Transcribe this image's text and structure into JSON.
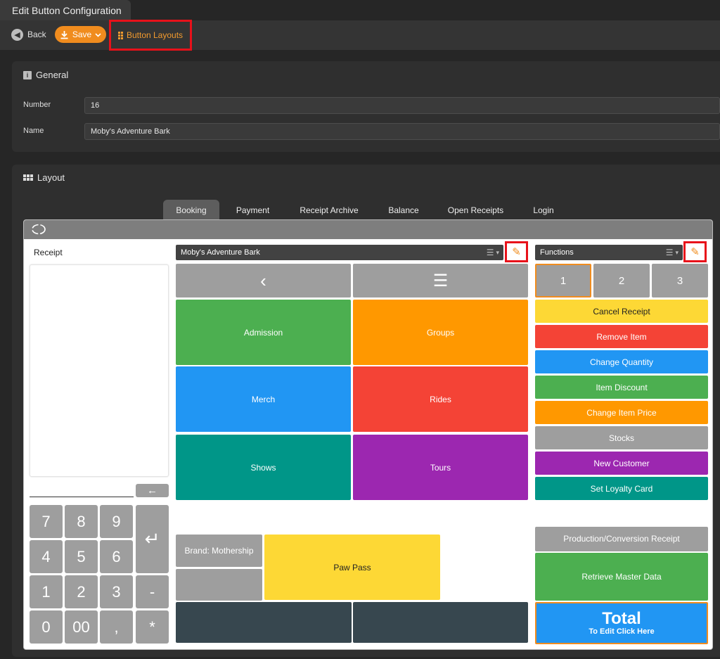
{
  "window": {
    "title": "Edit Button Configuration"
  },
  "toolbar": {
    "back_label": "Back",
    "save_label": "Save",
    "layouts_label": "Button Layouts"
  },
  "general": {
    "title": "General",
    "number_label": "Number",
    "number_value": "16",
    "name_label": "Name",
    "name_value": "Moby's Adventure Bark"
  },
  "layout": {
    "title": "Layout",
    "tabs": [
      {
        "label": "Booking",
        "active": true
      },
      {
        "label": "Payment"
      },
      {
        "label": "Receipt Archive"
      },
      {
        "label": "Balance"
      },
      {
        "label": "Open Receipts"
      },
      {
        "label": "Login"
      }
    ]
  },
  "pos": {
    "receipt_label": "Receipt",
    "main_dropdown": "Moby's Adventure Bark",
    "functions_dropdown": "Functions",
    "nav": {
      "back_glyph": "‹",
      "menu_glyph": "☰"
    },
    "category_tiles": [
      {
        "label": "Admission",
        "color": "#4caf50"
      },
      {
        "label": "Groups",
        "color": "#ff9800"
      },
      {
        "label": "Merch",
        "color": "#2196f3"
      },
      {
        "label": "Rides",
        "color": "#f44336"
      },
      {
        "label": "Shows",
        "color": "#009688"
      },
      {
        "label": "Tours",
        "color": "#9c27b0"
      }
    ],
    "brand_label": "Brand: Mothership",
    "paw_pass_label": "Paw Pass",
    "page_tabs": [
      "1",
      "2",
      "3"
    ],
    "functions": [
      {
        "label": "Cancel Receipt",
        "color": "#fdd835"
      },
      {
        "label": "Remove Item",
        "color": "#f44336"
      },
      {
        "label": "Change Quantity",
        "color": "#2196f3"
      },
      {
        "label": "Item Discount",
        "color": "#4caf50"
      },
      {
        "label": "Change Item Price",
        "color": "#ff9800"
      },
      {
        "label": "Stocks",
        "color": "#9e9e9e"
      },
      {
        "label": "New Customer",
        "color": "#9c27b0"
      },
      {
        "label": "Set Loyalty Card",
        "color": "#009688"
      }
    ],
    "production_label": "Production/Conversion Receipt",
    "retrieve_label": "Retrieve Master Data",
    "total_label": "Total",
    "total_sub": "To Edit Click Here",
    "keypad": [
      "7",
      "8",
      "9",
      "4",
      "5",
      "6",
      "1",
      "2",
      "3",
      "0",
      "00",
      ","
    ],
    "keypad_ops": [
      "-",
      "*"
    ],
    "enter_glyph": "↵",
    "backspace_glyph": "←"
  }
}
